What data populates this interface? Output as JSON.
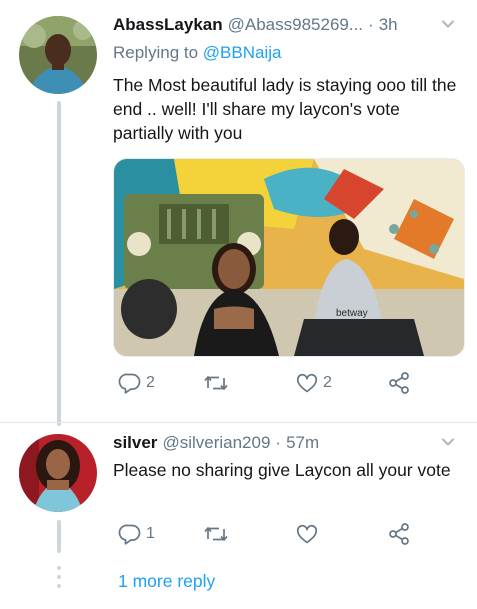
{
  "tweet1": {
    "name": "AbassLaykan",
    "handle": "@Abass985269...",
    "dot": "·",
    "time": "3h",
    "replying_prefix": "Replying to",
    "replying_to": "@BBNaija",
    "text": "The Most beautiful lady is staying ooo till the end .. well! I'll share my laycon's vote partially with you",
    "media_text": "betway",
    "reply_count": "2",
    "like_count": "2"
  },
  "tweet2": {
    "name": "silver",
    "handle": "@silverian209",
    "dot": "·",
    "time": "57m",
    "text": "Please no sharing give Laycon all your vote",
    "reply_count": "1"
  },
  "more_replies": "1 more reply",
  "colors": {
    "accent": "#1da1f2",
    "secondary_text": "#657786",
    "thread_line": "#ccd6dd"
  },
  "icons": [
    "reply-icon",
    "retweet-icon",
    "like-icon",
    "share-icon",
    "chevron-down-icon"
  ]
}
